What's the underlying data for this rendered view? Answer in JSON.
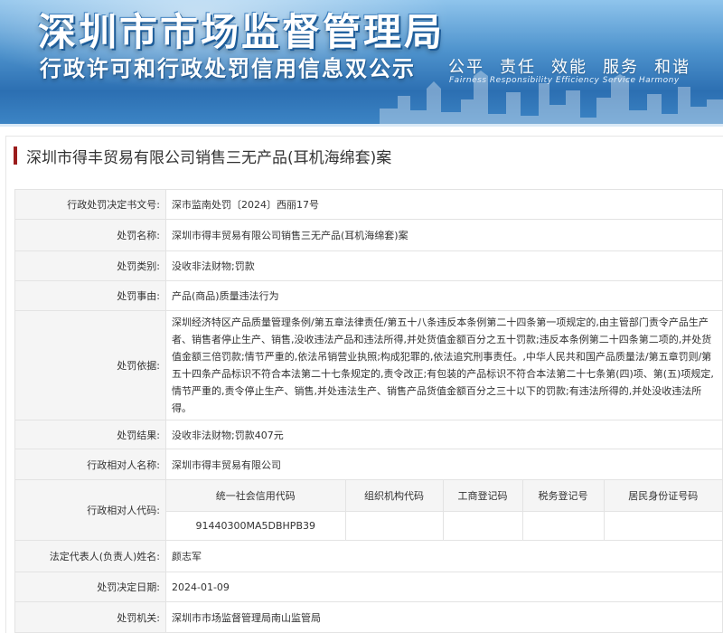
{
  "banner": {
    "title": "深圳市市场监督管理局",
    "subtitle": "行政许可和行政处罚信用信息双公示",
    "motto": [
      "公平",
      "责任",
      "效能",
      "服务",
      "和谐"
    ],
    "motto_en": "Fairness  Responsibility  Efficiency  Service  Harmony"
  },
  "case_title": "深圳市得丰贸易有限公司销售三无产品(耳机海绵套)案",
  "fields": {
    "doc_no": {
      "label": "行政处罚决定书文号:",
      "value": "深市监南处罚〔2024〕西丽17号"
    },
    "name": {
      "label": "处罚名称:",
      "value": "深圳市得丰贸易有限公司销售三无产品(耳机海绵套)案"
    },
    "category": {
      "label": "处罚类别:",
      "value": "没收非法财物;罚款"
    },
    "reason": {
      "label": "处罚事由:",
      "value": "产品(商品)质量违法行为"
    },
    "basis": {
      "label": "处罚依据:",
      "value": "深圳经济特区产品质量管理条例/第五章法律责任/第五十八条违反本条例第二十四条第一项规定的,由主管部门责令产品生产者、销售者停止生产、销售,没收违法产品和违法所得,并处货值金额百分之五十罚款;违反本条例第二十四条第二项的,并处货值金额三倍罚款;情节严重的,依法吊销营业执照;构成犯罪的,依法追究刑事责任。,中华人民共和国产品质量法/第五章罚则/第五十四条产品标识不符合本法第二十七条规定的,责令改正;有包装的产品标识不符合本法第二十七条第(四)项、第(五)项规定,情节严重的,责令停止生产、销售,并处违法生产、销售产品货值金额百分之三十以下的罚款;有违法所得的,并处没收违法所得。"
    },
    "result": {
      "label": "处罚结果:",
      "value": "没收非法财物;罚款407元"
    },
    "party": {
      "label": "行政相对人名称:",
      "value": "深圳市得丰贸易有限公司"
    },
    "party_codes": {
      "label": "行政相对人代码:",
      "headers": [
        "统一社会信用代码",
        "组织机构代码",
        "工商登记码",
        "税务登记号",
        "居民身份证号码"
      ],
      "values": [
        "91440300MA5DBHPB39",
        "",
        "",
        "",
        ""
      ]
    },
    "legal_rep": {
      "label": "法定代表人(负责人)姓名:",
      "value": "颜志军"
    },
    "date": {
      "label": "处罚决定日期:",
      "value": "2024-01-09"
    },
    "authority": {
      "label": "处罚机关:",
      "value": "深圳市市场监督管理局南山监管局"
    }
  },
  "colors": {
    "banner_blue": "#2c6fb2",
    "title_accent": "#9b1c1c",
    "label_bg": "#f5f5f5",
    "border": "#e3e3e3"
  }
}
